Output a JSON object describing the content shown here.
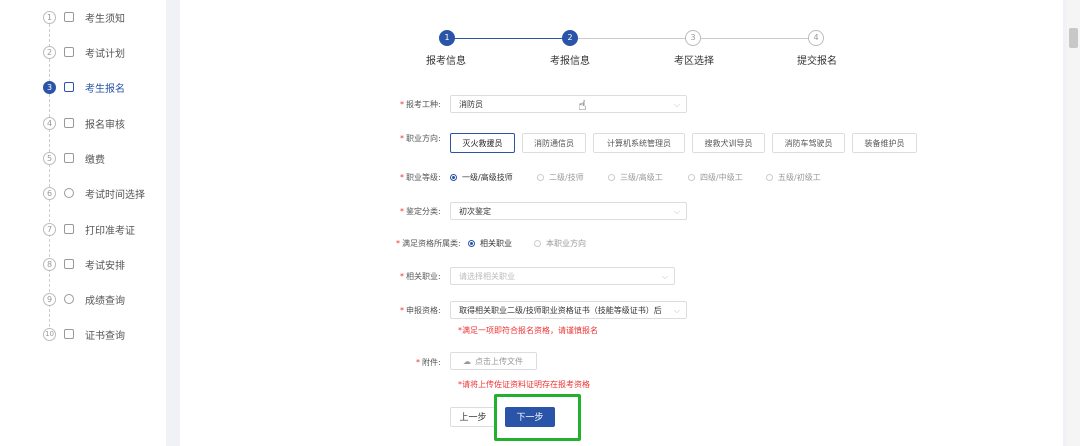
{
  "sidebar": {
    "steps": [
      {
        "num": "1",
        "label": "考生须知",
        "icon": "camera-icon"
      },
      {
        "num": "2",
        "label": "考试计划",
        "icon": "calendar-icon"
      },
      {
        "num": "3",
        "label": "考生报名",
        "icon": "form-icon",
        "active": true
      },
      {
        "num": "4",
        "label": "报名审核",
        "icon": "review-icon"
      },
      {
        "num": "5",
        "label": "缴费",
        "icon": "wallet-icon"
      },
      {
        "num": "6",
        "label": "考试时间选择",
        "icon": "clock-icon"
      },
      {
        "num": "7",
        "label": "打印准考证",
        "icon": "printer-icon"
      },
      {
        "num": "8",
        "label": "考试安排",
        "icon": "schedule-icon"
      },
      {
        "num": "9",
        "label": "成绩查询",
        "icon": "search-icon"
      },
      {
        "num": "10",
        "label": "证书查询",
        "icon": "certificate-icon"
      }
    ]
  },
  "progress": {
    "steps": [
      {
        "num": "1",
        "label": "报考信息",
        "done": true
      },
      {
        "num": "2",
        "label": "考报信息",
        "done": true
      },
      {
        "num": "3",
        "label": "考区选择",
        "done": false
      },
      {
        "num": "4",
        "label": "提交报名",
        "done": false
      }
    ]
  },
  "form": {
    "job_type": {
      "label": "报考工种:",
      "value": "消防员"
    },
    "direction": {
      "label": "职业方向:",
      "options": [
        "灭火救援员",
        "消防通信员",
        "计算机系统管理员",
        "搜救犬训导员",
        "消防车驾驶员",
        "装备维护员"
      ]
    },
    "level": {
      "label": "职业等级:",
      "options": [
        "一级/高级技师",
        "二级/技师",
        "三级/高级工",
        "四级/中级工",
        "五级/初级工"
      ]
    },
    "category": {
      "label": "鉴定分类:",
      "value": "初次鉴定"
    },
    "qualification": {
      "label": "满足资格所属类:",
      "options": [
        "相关职业",
        "本职业方向"
      ]
    },
    "related_job": {
      "label": "相关职业:",
      "placeholder": "请选择相关职业"
    },
    "apply_qual": {
      "label": "申报资格:",
      "value": "取得相关职业二级/技师职业资格证书（技能等级证书）后",
      "hint": "*满足一项即符合报名资格，请谨慎报名"
    },
    "attachment": {
      "label": "附件:",
      "button": "点击上传文件",
      "hint": "*请将上传佐证资料证明存在报考资格"
    }
  },
  "buttons": {
    "prev": "上一步",
    "next": "下一步"
  },
  "colors": {
    "primary": "#2a54a7",
    "required": "#ee3333",
    "highlight": "#22b02e"
  }
}
